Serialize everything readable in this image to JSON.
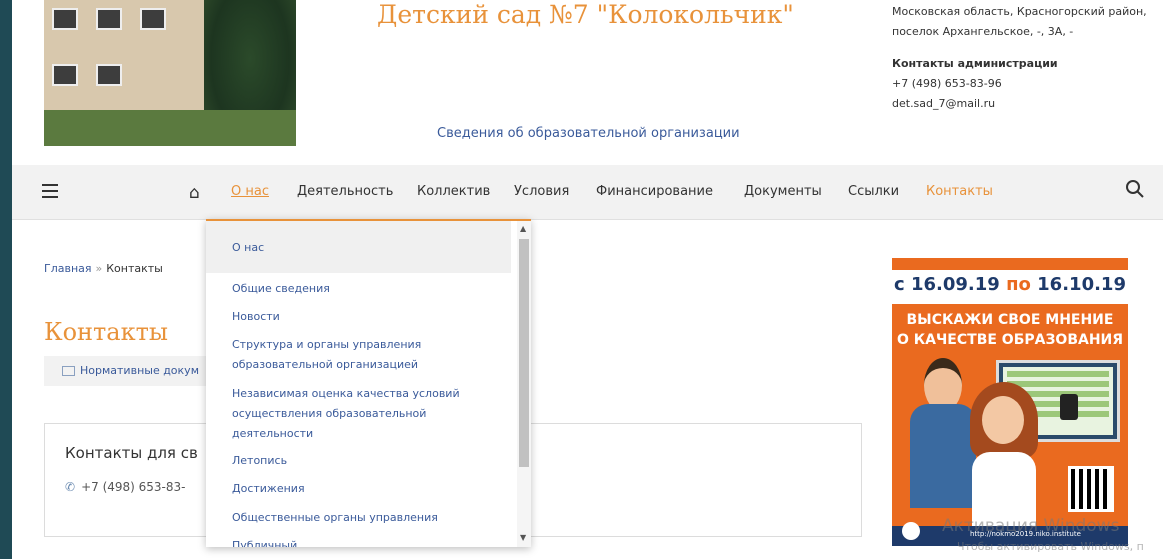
{
  "header": {
    "title": "Детский сад №7 \"Колокольчик\"",
    "info_link": "Сведения об образовательной организации",
    "address": "Московская область, Красногорский район, поселок Архангельское, -, 3А, -",
    "contacts_heading": "Контакты администрации",
    "phone": "+7 (498) 653-83-96",
    "email": "det.sad_7@mail.ru"
  },
  "nav": {
    "items": [
      {
        "label": "О нас"
      },
      {
        "label": "Деятельность"
      },
      {
        "label": "Коллектив"
      },
      {
        "label": "Условия"
      },
      {
        "label": "Финансирование"
      },
      {
        "label": "Документы"
      },
      {
        "label": "Ссылки"
      },
      {
        "label": "Контакты"
      }
    ]
  },
  "dropdown": {
    "header": "О нас",
    "items": [
      "Общие сведения",
      "Новости",
      "Структура и органы управления образовательной организацией",
      "Независимая оценка качества условий осуществления образовательной деятельности",
      "Летопись",
      "Достижения",
      "Общественные органы управления",
      "Публичный..."
    ]
  },
  "breadcrumb": {
    "home": "Главная",
    "sep": "»",
    "current": "Контакты"
  },
  "main": {
    "title": "Контакты",
    "doc_link": "Нормативные докум",
    "card_heading": "Контакты для св",
    "card_phone": "+7 (498) 653-83-"
  },
  "banner": {
    "date_from": "с 16.09.19",
    "po": "по",
    "date_to": "16.10.19",
    "slogan_1": "ВЫСКАЖИ СВОЕ МНЕНИЕ",
    "slogan_2": "О КАЧЕСТВЕ ОБРАЗОВАНИЯ",
    "url": "http://nokmo2019.niko.institute"
  },
  "watermark": {
    "line1": "Активация Windows",
    "line2": "Чтобы активировать Windows, п"
  },
  "colors": {
    "accent": "#e8923a",
    "link": "#3a5a9a",
    "banner": "#ea6a1f",
    "frame": "#1f4a55"
  }
}
